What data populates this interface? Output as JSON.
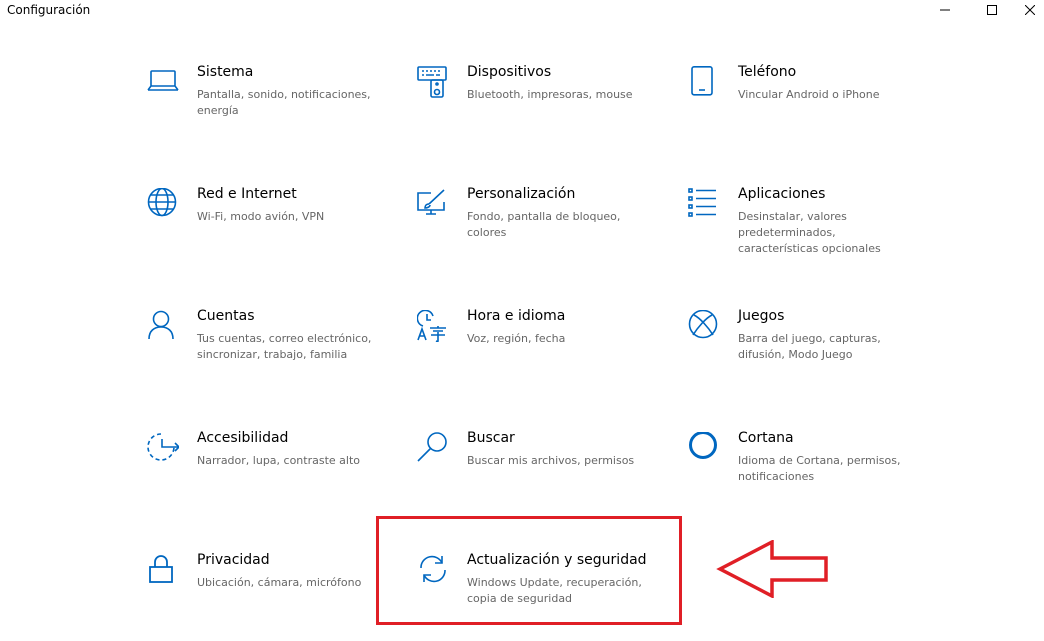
{
  "window": {
    "title": "Configuración",
    "controls": {
      "minimize": "minimize-icon",
      "maximize": "maximize-icon",
      "close": "close-icon"
    }
  },
  "colors": {
    "accent": "#0067c0",
    "highlight": "#e01f26",
    "description": "#666666"
  },
  "tiles": [
    {
      "name": "Sistema",
      "desc": "Pantalla, sonido, notificaciones, energía",
      "icon": "laptop-icon"
    },
    {
      "name": "Dispositivos",
      "desc": "Bluetooth, impresoras, mouse",
      "icon": "devices-icon"
    },
    {
      "name": "Teléfono",
      "desc": "Vincular Android o iPhone",
      "icon": "phone-icon"
    },
    {
      "name": "Red e Internet",
      "desc": "Wi-Fi, modo avión, VPN",
      "icon": "globe-icon"
    },
    {
      "name": "Personalización",
      "desc": "Fondo, pantalla de bloqueo, colores",
      "icon": "paint-icon"
    },
    {
      "name": "Aplicaciones",
      "desc": "Desinstalar, valores predeterminados, características opcionales",
      "icon": "apps-list-icon"
    },
    {
      "name": "Cuentas",
      "desc": "Tus cuentas, correo electrónico, sincronizar, trabajo, familia",
      "icon": "person-icon"
    },
    {
      "name": "Hora e idioma",
      "desc": "Voz, región, fecha",
      "icon": "time-language-icon"
    },
    {
      "name": "Juegos",
      "desc": "Barra del juego, capturas, difusión, Modo Juego",
      "icon": "xbox-icon"
    },
    {
      "name": "Accesibilidad",
      "desc": "Narrador, lupa, contraste alto",
      "icon": "accessibility-icon"
    },
    {
      "name": "Buscar",
      "desc": "Buscar mis archivos, permisos",
      "icon": "search-icon"
    },
    {
      "name": "Cortana",
      "desc": "Idioma de Cortana, permisos, notificaciones",
      "icon": "cortana-icon"
    },
    {
      "name": "Privacidad",
      "desc": "Ubicación, cámara, micrófono",
      "icon": "lock-icon"
    },
    {
      "name": "Actualización y seguridad",
      "desc": "Windows Update, recuperación, copia de seguridad",
      "icon": "sync-icon"
    }
  ],
  "annotation": {
    "highlight": "red-highlight-box",
    "arrow": "red-arrow-icon"
  }
}
